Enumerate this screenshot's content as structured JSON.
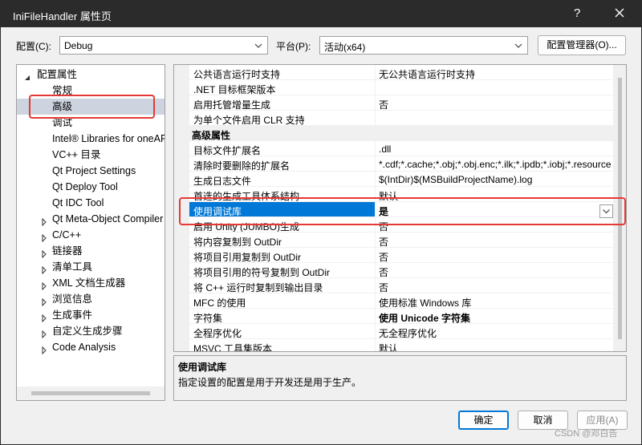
{
  "window": {
    "title": "IniFileHandler 属性页",
    "help_label": "?",
    "close_icon": "close-icon"
  },
  "toolbar": {
    "config_label": "配置(C):",
    "config_value": "Debug",
    "platform_label": "平台(P):",
    "platform_value": "活动(x64)",
    "config_manager_label": "配置管理器(O)..."
  },
  "tree": {
    "root": "配置属性",
    "items": [
      {
        "label": "常规",
        "expandable": false
      },
      {
        "label": "高级",
        "expandable": false,
        "selected": true
      },
      {
        "label": "调试",
        "expandable": false
      },
      {
        "label": "Intel® Libraries for oneAPI",
        "expandable": false
      },
      {
        "label": "VC++ 目录",
        "expandable": false
      },
      {
        "label": "Qt Project Settings",
        "expandable": false
      },
      {
        "label": "Qt Deploy Tool",
        "expandable": false
      },
      {
        "label": "Qt IDC Tool",
        "expandable": false
      },
      {
        "label": "Qt Meta-Object Compiler",
        "expandable": true
      },
      {
        "label": "C/C++",
        "expandable": true
      },
      {
        "label": "链接器",
        "expandable": true
      },
      {
        "label": "清单工具",
        "expandable": true
      },
      {
        "label": "XML 文档生成器",
        "expandable": true
      },
      {
        "label": "浏览信息",
        "expandable": true
      },
      {
        "label": "生成事件",
        "expandable": true
      },
      {
        "label": "自定义生成步骤",
        "expandable": true
      },
      {
        "label": "Code Analysis",
        "expandable": true
      }
    ]
  },
  "grid": {
    "rows": [
      {
        "name": "公共语言运行时支持",
        "value": "无公共语言运行时支持"
      },
      {
        "name": ".NET 目标框架版本",
        "value": ""
      },
      {
        "name": "启用托管增量生成",
        "value": "否"
      },
      {
        "name": "为单个文件启用 CLR 支持",
        "value": ""
      },
      {
        "name": "高级属性",
        "value": "",
        "section": true
      },
      {
        "name": "目标文件扩展名",
        "value": ".dll"
      },
      {
        "name": "清除时要删除的扩展名",
        "value": "*.cdf;*.cache;*.obj;*.obj.enc;*.ilk;*.ipdb;*.iobj;*.resources"
      },
      {
        "name": "生成日志文件",
        "value": "$(IntDir)$(MSBuildProjectName).log"
      },
      {
        "name": "首选的生成工具体系结构",
        "value": "默认"
      },
      {
        "name": "使用调试库",
        "value": "是",
        "selected": true
      },
      {
        "name": "启用 Unity (JUMBO)生成",
        "value": "否"
      },
      {
        "name": "将内容复制到 OutDir",
        "value": "否"
      },
      {
        "name": "将项目引用复制到 OutDir",
        "value": "否"
      },
      {
        "name": "将项目引用的符号复制到 OutDir",
        "value": "否"
      },
      {
        "name": "将 C++ 运行时复制到输出目录",
        "value": "否"
      },
      {
        "name": "MFC 的使用",
        "value": "使用标准 Windows 库"
      },
      {
        "name": "字符集",
        "value": "使用 Unicode 字符集",
        "bold": true
      },
      {
        "name": "全程序优化",
        "value": "无全程序优化"
      },
      {
        "name": "MSVC 工具集版本",
        "value": "默认"
      }
    ]
  },
  "description": {
    "title": "使用调试库",
    "text": "指定设置的配置是用于开发还是用于生产。"
  },
  "buttons": {
    "ok": "确定",
    "cancel": "取消",
    "apply": "应用(A)"
  },
  "watermark": "CSDN @邓白告",
  "colors": {
    "selection": "#0078d7",
    "tree_selection": "#cdd3df",
    "highlight_box": "#e53935",
    "titlebar": "#2b2b2b"
  }
}
